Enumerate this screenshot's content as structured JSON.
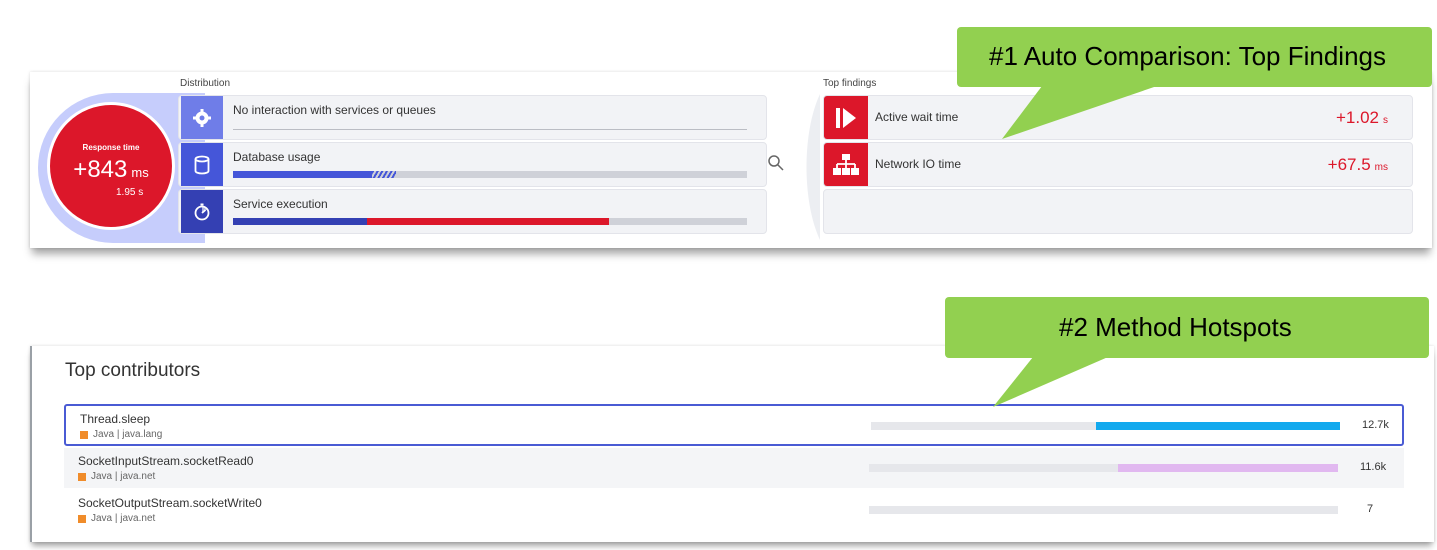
{
  "distribution": {
    "label": "Distribution",
    "response_time": {
      "title": "Response time",
      "value": "+843",
      "unit": "ms",
      "sub": "1.95 s"
    },
    "rows": [
      {
        "label": "No interaction with services or queues",
        "icon": "gear-icon"
      },
      {
        "label": "Database usage",
        "icon": "database-icon",
        "fill": 0.27
      },
      {
        "label": "Service execution",
        "icon": "stopwatch-icon",
        "fill_blue": 0.26,
        "fill_red": 0.47
      }
    ]
  },
  "top_findings": {
    "label": "Top findings",
    "items": [
      {
        "label": "Active wait time",
        "value": "+1.02",
        "unit": "s",
        "icon": "active-wait-icon"
      },
      {
        "label": "Network IO time",
        "value": "+67.5",
        "unit": "ms",
        "icon": "network-icon"
      }
    ]
  },
  "callouts": {
    "first": "#1 Auto Comparison: Top Findings",
    "second": "#2 Method Hotspots"
  },
  "top_contributors": {
    "title": "Top contributors",
    "rows": [
      {
        "name": "Thread.sleep",
        "meta": "Java | java.lang",
        "value": "12.7k",
        "fill": 0.52,
        "color": "#12a9ee"
      },
      {
        "name": "SocketInputStream.socketRead0",
        "meta": "Java | java.net",
        "value": "11.6k",
        "fill": 0.47,
        "color": "#e1b8f0"
      },
      {
        "name": "SocketOutputStream.socketWrite0",
        "meta": "Java | java.net",
        "value": "7",
        "fill": 0,
        "color": "#e1b8f0"
      }
    ]
  },
  "colors": {
    "accent_red": "#dc172a",
    "dynatrace_purple": "#6f7de8",
    "callout_green": "#92d050"
  }
}
